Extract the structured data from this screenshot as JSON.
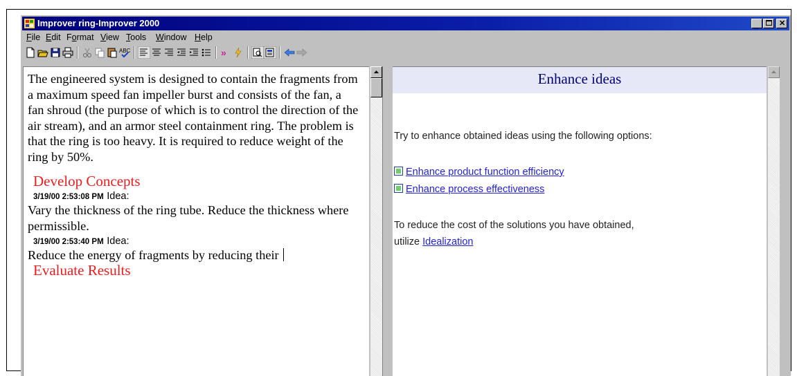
{
  "window": {
    "title": "Improver ring-Improver 2000"
  },
  "menu": [
    {
      "label": "File",
      "key": "F"
    },
    {
      "label": "Edit",
      "key": "E"
    },
    {
      "label": "Format",
      "key": "o"
    },
    {
      "label": "View",
      "key": "V"
    },
    {
      "label": "Tools",
      "key": "T"
    },
    {
      "label": "Window",
      "key": "W"
    },
    {
      "label": "Help",
      "key": "H"
    }
  ],
  "toolbar_icons": [
    "new-document-icon",
    "open-folder-icon",
    "save-icon",
    "print-icon",
    "cut-icon",
    "copy-icon",
    "paste-icon",
    "spellcheck-icon",
    "align-left-icon",
    "align-center-icon",
    "align-right-icon",
    "decrease-indent-icon",
    "increase-indent-icon",
    "bullet-list-icon",
    "next-step-icon",
    "wizard-icon",
    "find-icon",
    "report-icon",
    "back-arrow-icon",
    "forward-arrow-icon"
  ],
  "editor": {
    "problem_text": "The engineered system is designed to contain the fragments from a maximum speed fan impeller burst and consists of the fan, a fan shroud (the purpose of which is to control the direction of the air stream), and an armor steel containment ring.  The problem is that the ring is too heavy.  It is required to reduce weight of the ring by 50%.",
    "develop_heading": "Develop Concepts",
    "ideas": [
      {
        "timestamp": "3/19/00 2:53:08 PM",
        "label": "Idea:",
        "text": "Vary the thickness of the ring tube.  Reduce the thickness where permissible."
      },
      {
        "timestamp": "3/19/00 2:53:40 PM",
        "label": "Idea:",
        "text": "Reduce the energy of fragments by reducing their"
      }
    ],
    "evaluate_heading": "Evaluate Results"
  },
  "side_panel": {
    "title": "Enhance ideas",
    "intro": "Try to enhance obtained ideas using the following options:",
    "options": [
      "Enhance product function efficiency",
      "Enhance process effectiveness"
    ],
    "cost_text_line1": "To reduce the cost of the solutions you have obtained,",
    "cost_text_prefix": "utilize",
    "cost_link": "Idealization"
  },
  "colors": {
    "heading_red": "#ee1c1c",
    "link_blue": "#2222dd",
    "panel_title": "#000080",
    "titlebar": "#00007b"
  }
}
